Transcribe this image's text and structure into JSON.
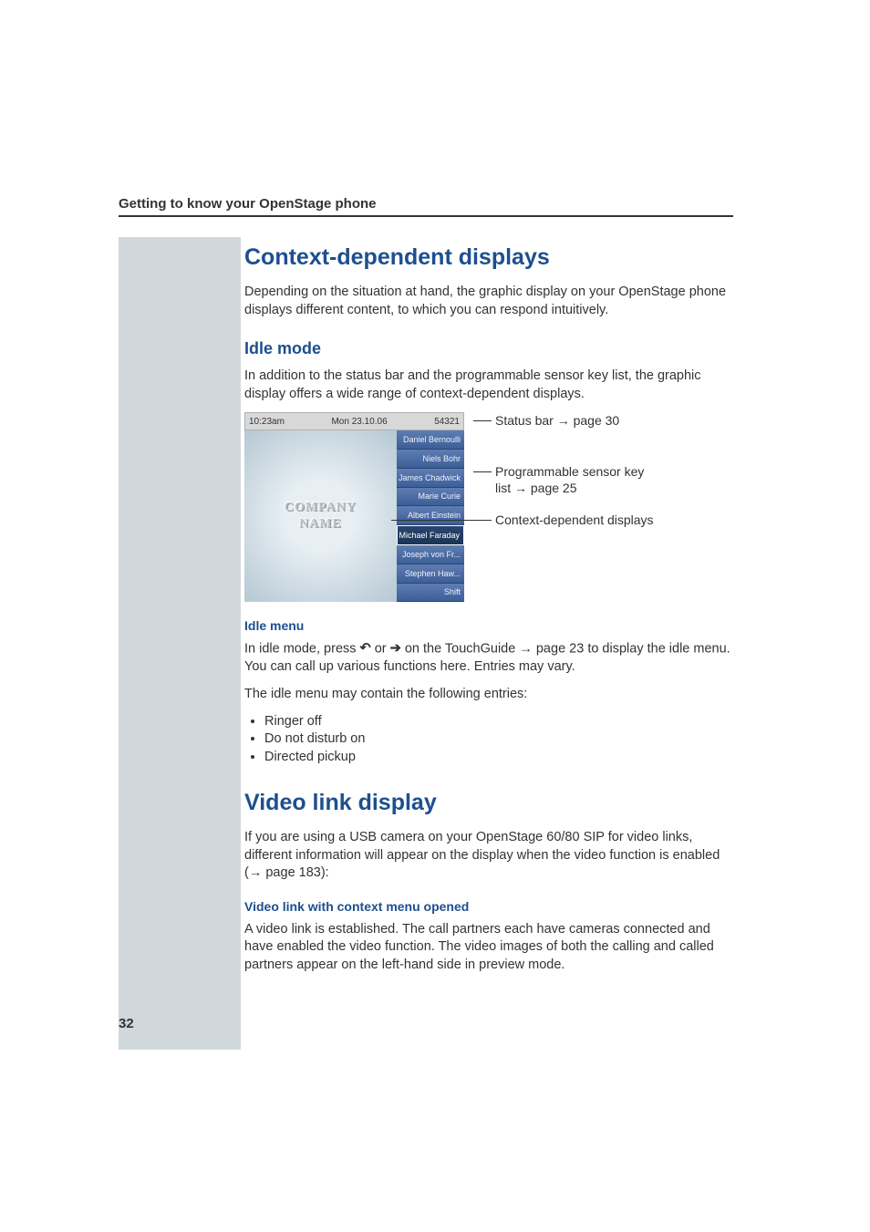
{
  "header": "Getting to know your OpenStage phone",
  "page_number": "32",
  "section1": {
    "title": "Context-dependent displays",
    "intro": "Depending on the situation at hand, the graphic display on your OpenStage phone displays different content, to which you can respond intuitively."
  },
  "idle_mode": {
    "title": "Idle mode",
    "intro": "In addition to the status bar and the programmable sensor key list, the graphic display offers a wide range of context-dependent displays."
  },
  "figure": {
    "status_bar": {
      "time": "10:23am",
      "date": "Mon 23.10.06",
      "ext": "54321"
    },
    "company_line1": "Company",
    "company_line2": "Name",
    "keys": [
      {
        "label": "Daniel Bernoulli",
        "selected": false
      },
      {
        "label": "Niels Bohr",
        "selected": false
      },
      {
        "label": "James Chadwick",
        "selected": false
      },
      {
        "label": "Marie Curie",
        "selected": false
      },
      {
        "label": "Albert Einstein",
        "selected": false
      },
      {
        "label": "Michael Faraday",
        "selected": true
      },
      {
        "label": "Joseph von Fr...",
        "selected": false
      },
      {
        "label": "Stephen Haw...",
        "selected": false
      },
      {
        "label": "Shift",
        "selected": false
      }
    ],
    "callouts": {
      "status_bar": {
        "pre": "Status bar ",
        "arrow": "→",
        "post": " page 30"
      },
      "sensor_keys": {
        "line1": "Programmable sensor key",
        "line2_pre": "list ",
        "arrow": "→",
        "line2_post": " page 25"
      },
      "context": "Context-dependent displays"
    }
  },
  "idle_menu": {
    "title": "Idle menu",
    "p1_pre": "In idle mode, press ",
    "p1_mid": " or ",
    "p1_post_a": " on the TouchGuide ",
    "p1_arrow": "→",
    "p1_post_b": " page 23 to display the idle menu. You can call up various functions here. Entries may vary.",
    "p2": "The idle menu may contain the following entries:",
    "items": [
      "Ringer off",
      "Do not disturb on",
      "Directed pickup"
    ]
  },
  "video": {
    "title": "Video link display",
    "p1_a": "If you are using a USB camera on your OpenStage 60/80 SIP for video links, different information will appear on the display when the video function is enabled (",
    "p1_arrow": "→",
    "p1_b": " page 183):",
    "sub_title": "Video link with context menu opened",
    "p2": "A video link is established. The call partners each have cameras connected and have enabled the video function. The video images of both the calling and called partners appear on the left-hand side in preview mode."
  }
}
